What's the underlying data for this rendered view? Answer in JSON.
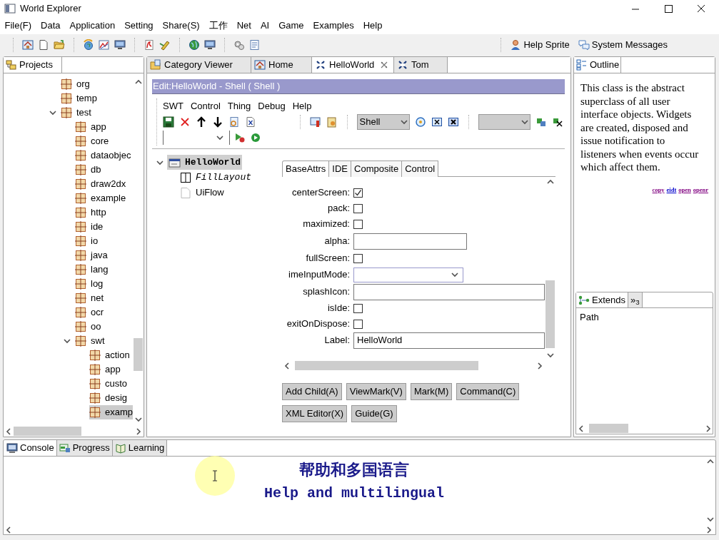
{
  "window": {
    "title": "World Explorer"
  },
  "menu": [
    "File(F)",
    "Data",
    "Application",
    "Setting",
    "Share(S)",
    "工作",
    "Net",
    "AI",
    "Game",
    "Examples",
    "Help"
  ],
  "toolbar": {
    "links": [
      "Help Sprite",
      "System Messages"
    ]
  },
  "projects": {
    "tab": "Projects",
    "tree": [
      {
        "label": "org",
        "selected": false
      },
      {
        "label": "temp",
        "selected": false
      },
      {
        "label": "test",
        "selected": false,
        "expanded": true,
        "children": [
          {
            "label": "app",
            "selected": false
          },
          {
            "label": "core",
            "selected": false
          },
          {
            "label": "dataobjec",
            "selected": false
          },
          {
            "label": "db",
            "selected": false
          },
          {
            "label": "draw2dx",
            "selected": false
          },
          {
            "label": "example",
            "selected": false
          },
          {
            "label": "http",
            "selected": false
          },
          {
            "label": "ide",
            "selected": false
          },
          {
            "label": "io",
            "selected": false
          },
          {
            "label": "java",
            "selected": false
          },
          {
            "label": "lang",
            "selected": false
          },
          {
            "label": "log",
            "selected": false
          },
          {
            "label": "net",
            "selected": false
          },
          {
            "label": "ocr",
            "selected": false
          },
          {
            "label": "oo",
            "selected": false
          },
          {
            "label": "swt",
            "selected": false,
            "expanded": true,
            "children": [
              {
                "label": "action",
                "selected": false
              },
              {
                "label": "app",
                "selected": false
              },
              {
                "label": "custo",
                "selected": false
              },
              {
                "label": "desig",
                "selected": false
              },
              {
                "label": "examp",
                "selected": true
              }
            ]
          }
        ]
      }
    ]
  },
  "editor": {
    "tabs": [
      {
        "label": "Category Viewer",
        "selected": false,
        "closable": false
      },
      {
        "label": "Home",
        "selected": false,
        "closable": false
      },
      {
        "label": "HelloWorld",
        "selected": true,
        "closable": true
      },
      {
        "label": "Tom",
        "selected": false,
        "closable": false
      }
    ],
    "header": "Edit:HelloWorld - Shell ( Shell )",
    "menu": [
      "SWT",
      "Control",
      "Thing",
      "Debug",
      "Help"
    ],
    "class_combo": "Shell",
    "tree": [
      {
        "label": "HelloWorld",
        "kind": "shell",
        "selected": true,
        "expanded": true,
        "children": [
          {
            "label": "FillLayout",
            "kind": "layout",
            "selected": false
          },
          {
            "label": "UiFlow",
            "kind": "flow",
            "selected": false
          }
        ]
      }
    ],
    "property_tabs": [
      {
        "label": "BaseAttrs",
        "selected": true
      },
      {
        "label": "IDE",
        "selected": false
      },
      {
        "label": "Composite",
        "selected": false
      },
      {
        "label": "Control",
        "selected": false
      }
    ],
    "properties": [
      {
        "label": "centerScreen:",
        "kind": "checkbox",
        "checked": true
      },
      {
        "label": "pack:",
        "kind": "checkbox",
        "checked": false
      },
      {
        "label": "maximized:",
        "kind": "checkbox",
        "checked": false
      },
      {
        "label": "alpha:",
        "kind": "text"
      },
      {
        "label": "fullScreen:",
        "kind": "checkbox",
        "checked": false
      },
      {
        "label": "imeInputMode:",
        "kind": "combo"
      },
      {
        "label": "splashIcon:",
        "kind": "text"
      },
      {
        "label": "isIde:",
        "kind": "checkbox",
        "checked": false
      },
      {
        "label": "exitOnDispose:",
        "kind": "checkbox",
        "checked": false
      },
      {
        "label": "Label:",
        "kind": "text",
        "value": "HelloWorld"
      }
    ],
    "buttons": [
      "Add Child(A)",
      "ViewMark(V)",
      "Mark(M)",
      "Command(C)",
      "XML Editor(X)",
      "Guide(G)"
    ]
  },
  "outline": {
    "tab": "Outline",
    "description": "This class is the abstract superclass of all user interface objects. Widgets are created, disposed and issue notification to listeners when events occur which affect them.",
    "links": [
      {
        "label": "copy",
        "visited": true
      },
      {
        "label": "eidt",
        "visited": false
      },
      {
        "label": "open",
        "visited": true
      },
      {
        "label": "openr",
        "visited": true
      }
    ]
  },
  "extends": {
    "tabs": [
      {
        "label": "Extends",
        "selected": true
      },
      {
        "label": "»$_{3}$",
        "selected": false
      }
    ],
    "items": [
      "Path"
    ]
  },
  "console": {
    "tabs": [
      {
        "label": "Console",
        "selected": true
      },
      {
        "label": "Progress",
        "selected": false
      },
      {
        "label": "Learning",
        "selected": false
      }
    ],
    "lines": [
      "帮助和多国语言",
      "Help and multilingual"
    ]
  }
}
